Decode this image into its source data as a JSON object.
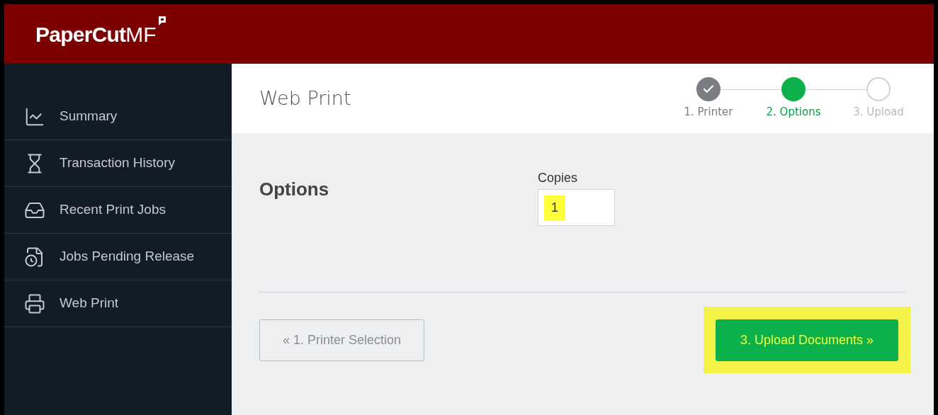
{
  "logo": {
    "name": "PaperCut",
    "suffix": "MF"
  },
  "sidebar": {
    "items": [
      {
        "label": "Summary",
        "kind": "chart"
      },
      {
        "label": "Transaction History",
        "kind": "hourglass"
      },
      {
        "label": "Recent Print Jobs",
        "kind": "tray"
      },
      {
        "label": "Jobs Pending Release",
        "kind": "pending"
      },
      {
        "label": "Web Print",
        "kind": "printer"
      }
    ]
  },
  "page": {
    "title": "Web Print"
  },
  "steps": [
    {
      "label": "1. Printer",
      "kind": "done"
    },
    {
      "label": "2. Options",
      "kind": "current"
    },
    {
      "label": "3. Upload",
      "kind": "todo"
    }
  ],
  "section": {
    "title": "Options"
  },
  "copies": {
    "label": "Copies",
    "value": "1",
    "highlighted": true
  },
  "buttons": [
    {
      "label": "« 1. Printer Selection",
      "kind": "secondary",
      "highlighted": false
    },
    {
      "label": "3. Upload Documents »",
      "kind": "primary",
      "highlighted": true
    }
  ]
}
